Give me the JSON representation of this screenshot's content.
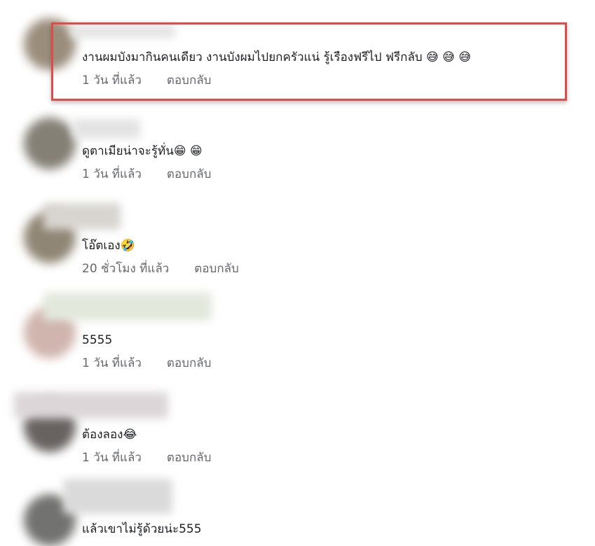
{
  "comments": [
    {
      "text": "งานผมบังมากินคนเดียว งานบังผมไปยกครัวแน่ รู้เรืองฟรีไป ฟรีกลับ 😅 😅 😅",
      "time": "1 วัน ที่แล้ว",
      "reply": "ตอบกลับ",
      "highlighted": true
    },
    {
      "text": "ดูตาเมียน่าจะรู้ทั่น😁 😁",
      "time": "1 วัน ที่แล้ว",
      "reply": "ตอบกลับ"
    },
    {
      "text": "โอ๊ตเอง🤣",
      "time": "20 ชั่วโมง ที่แล้ว",
      "reply": "ตอบกลับ"
    },
    {
      "text": "5555",
      "time": "1 วัน ที่แล้ว",
      "reply": "ตอบกลับ"
    },
    {
      "text": "ต้องลอง😂",
      "time": "1 วัน ที่แล้ว",
      "reply": "ตอบกลับ"
    },
    {
      "text": "แล้วเขาไม่รู้ด้วยน่ะ555",
      "time": "",
      "reply": ""
    }
  ],
  "colors": {
    "highlight_border": "#e24a4a",
    "meta_text": "#65676b",
    "body_text": "#1c1e21"
  }
}
